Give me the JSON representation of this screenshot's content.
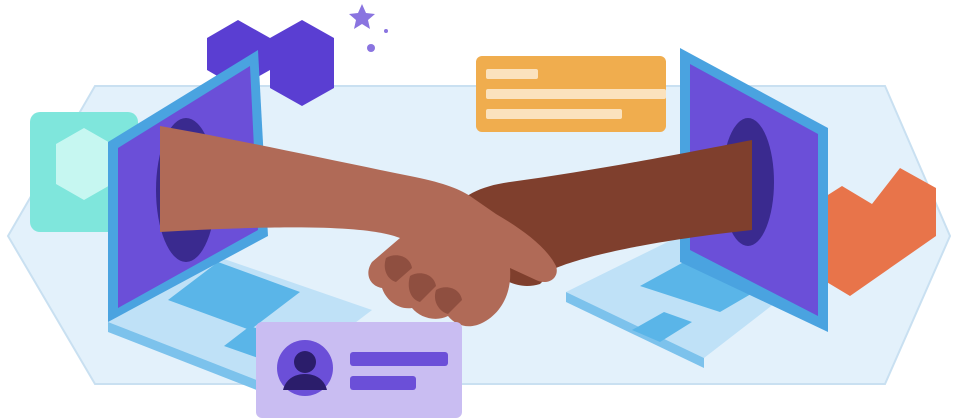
{
  "illustration": {
    "subject": "handshake-between-laptops",
    "colors": {
      "backdrop": "#e3f1fb",
      "backdrop_stroke": "#c9e0f1",
      "laptop_screen_frame": "#4aa3e0",
      "laptop_screen": "#6b4fd8",
      "laptop_screen_dark": "#3a2a8f",
      "laptop_base": "#bfe1f7",
      "laptop_base_edge": "#7cc2ec",
      "laptop_keys": "#5ab5e8",
      "left_arm": "#b06a57",
      "left_arm_shadow": "#8f4f40",
      "right_arm": "#7f3f2d",
      "right_arm_shadow": "#5f2c1e",
      "note_card": "#f0ad4e",
      "note_lines": "#fbe2bd",
      "profile_card": "#c9bdf2",
      "profile_lines": "#6b4fd8",
      "avatar_bg": "#6b4fd8",
      "avatar_fg": "#2b1d6b",
      "purple_hex": "#5a3ed2",
      "teal_tile": "#7fe6dc",
      "orange_block": "#e8744a",
      "sparkle": "#8a74e0"
    },
    "icons": [
      "star-sparkle-icon",
      "user-avatar-icon",
      "hexagon-icon"
    ]
  }
}
